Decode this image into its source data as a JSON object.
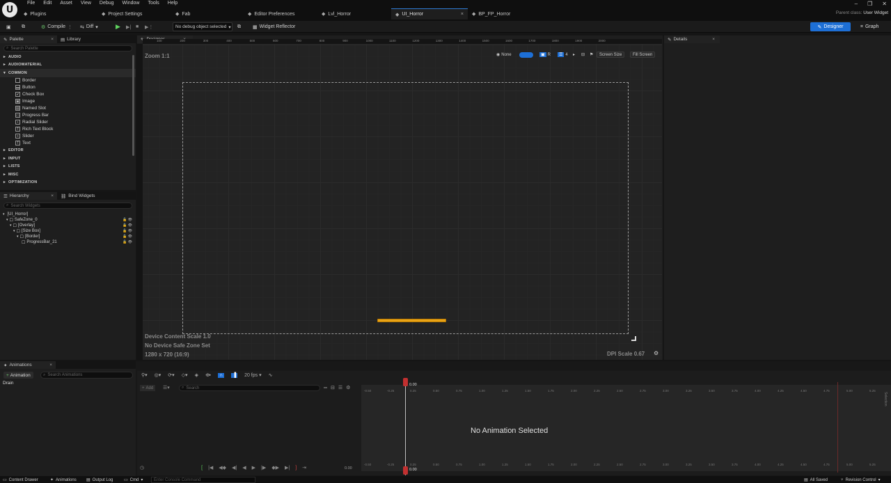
{
  "menu": [
    "File",
    "Edit",
    "Asset",
    "View",
    "Debug",
    "Window",
    "Tools",
    "Help"
  ],
  "tabs": [
    {
      "label": "Plugins",
      "icon": "plug-icon"
    },
    {
      "label": "Project Settings",
      "icon": "gear-icon"
    },
    {
      "label": "Fab",
      "icon": "fab-icon"
    },
    {
      "label": "Editor Preferences",
      "icon": "sliders-icon"
    },
    {
      "label": "Lvl_Horror",
      "icon": "level-icon"
    },
    {
      "label": "UI_Horror",
      "icon": "widget-icon",
      "active": true
    },
    {
      "label": "BP_FP_Horror",
      "icon": "blueprint-icon"
    }
  ],
  "parent_class": {
    "label": "Parent class:",
    "value": "User Widget"
  },
  "toolbar": {
    "compile": "Compile",
    "diff": "Diff",
    "debug_object": "No debug object selected",
    "widget_reflector": "Widget Reflector",
    "designer": "Designer",
    "graph": "Graph"
  },
  "palette": {
    "tab": "Palette",
    "library_tab": "Library",
    "search_placeholder": "Search Palette",
    "categories_before": [
      "AUDIO",
      "AUDIOMATERIAL"
    ],
    "open_category": "COMMON",
    "items": [
      {
        "label": "Border",
        "glyph": ""
      },
      {
        "label": "Button",
        "glyph": "▬"
      },
      {
        "label": "Check Box",
        "glyph": "✔"
      },
      {
        "label": "Image",
        "glyph": "▣"
      },
      {
        "label": "Named Slot",
        "glyph": "▤"
      },
      {
        "label": "Progress Bar",
        "glyph": "▭"
      },
      {
        "label": "Radial Slider",
        "glyph": "•"
      },
      {
        "label": "Rich Text Block",
        "glyph": "T"
      },
      {
        "label": "Slider",
        "glyph": "+"
      },
      {
        "label": "Text",
        "glyph": "T"
      }
    ],
    "categories_after": [
      "EDITOR",
      "INPUT",
      "LISTS",
      "MISC",
      "OPTIMIZATION"
    ]
  },
  "hierarchy": {
    "tab": "Hierarchy",
    "bind_tab": "Bind Widgets",
    "search_placeholder": "Search Widgets",
    "rows": [
      {
        "label": "[UI_Horror]",
        "indent": 0
      },
      {
        "label": "SafeZone_0",
        "indent": 1
      },
      {
        "label": "[Overlay]",
        "indent": 2
      },
      {
        "label": "[Size Box]",
        "indent": 3
      },
      {
        "label": "[Border]",
        "indent": 4
      },
      {
        "label": "ProgressBar_21",
        "indent": 5
      }
    ]
  },
  "designer": {
    "tab": "Designer",
    "zoom": "Zoom 1:1",
    "none": "None",
    "r": "R",
    "grid": "4",
    "screen_size": "Screen Size",
    "fill_screen": "Fill Screen",
    "content_scale": "Device Content Scale 1.0",
    "safe_zone": "No Device Safe Zone Set",
    "resolution": "1280 x 720 (16:9)",
    "dpi": "DPI Scale 0.67",
    "ruler_h": [
      "100",
      "200",
      "300",
      "400",
      "500",
      "600",
      "700",
      "800",
      "900",
      "1000",
      "1100",
      "1200",
      "1300",
      "1400",
      "1500",
      "1600",
      "1700",
      "1800",
      "1900",
      "2000"
    ]
  },
  "details": {
    "tab": "Details"
  },
  "animations": {
    "tab": "Animations",
    "add": "Animation",
    "search_placeholder": "Search Animations",
    "items": [
      "Drain"
    ]
  },
  "timeline": {
    "add": "Add",
    "search_placeholder": "Search",
    "fps": "20 fps",
    "time": "0.00",
    "empty": "No Animation Selected",
    "ticks": [
      "-0.50",
      "-0.25",
      "0.25",
      "0.50",
      "0.75",
      "1.00",
      "1.25",
      "1.50",
      "1.75",
      "2.00",
      "2.25",
      "2.50",
      "2.75",
      "3.00",
      "3.25",
      "3.50",
      "3.75",
      "4.00",
      "4.25",
      "4.50",
      "4.75",
      "5.00",
      "5.25"
    ],
    "side_label": "Selection"
  },
  "statusbar": {
    "content_drawer": "Content Drawer",
    "animations": "Animations",
    "output_log": "Output Log",
    "cmd": "Cmd",
    "console_placeholder": "Enter Console Command",
    "saved": "All Saved",
    "revision": "Revision Control"
  }
}
